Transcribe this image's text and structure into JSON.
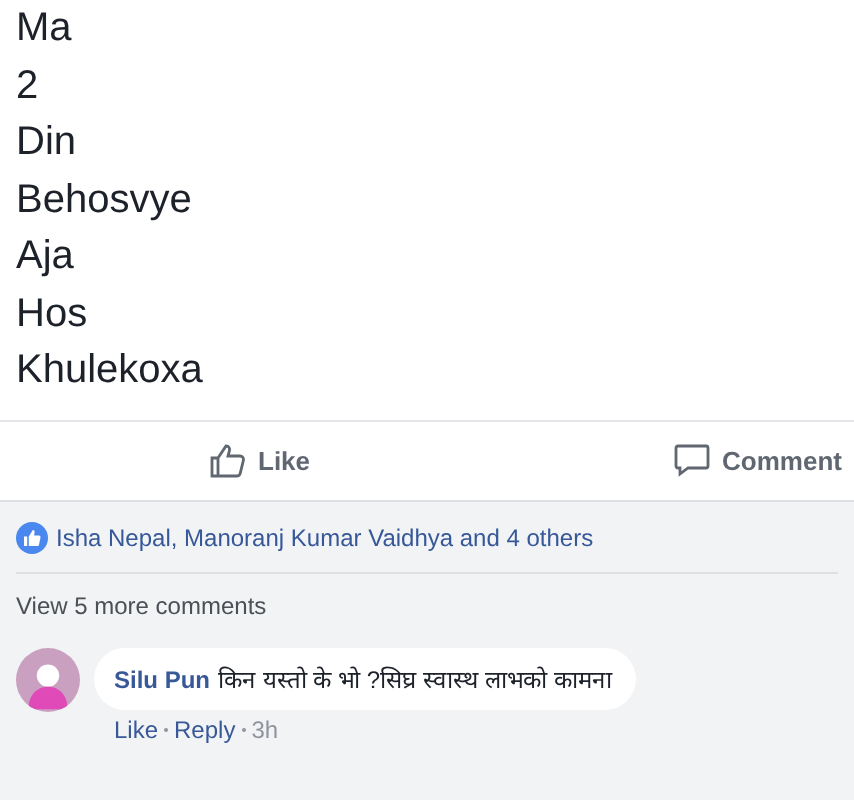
{
  "post": {
    "lines": [
      "Ma",
      "2",
      "Din",
      "Behosvye",
      "Aja",
      "Hos",
      "Khulekoxa"
    ]
  },
  "actions": [
    {
      "kind": "like",
      "label": "Like"
    },
    {
      "kind": "comment",
      "label": "Comment"
    }
  ],
  "reactions": {
    "text": "Isha Nepal, Manoranj Kumar Vaidhya and 4 others"
  },
  "more_comments": "View 5 more comments",
  "comments": [
    {
      "author": "Silu Pun",
      "text": "किन यस्तो के भो ?सिघ्र स्वास्थ लाभको कामना",
      "like": "Like",
      "reply": "Reply",
      "time": "3h"
    }
  ]
}
